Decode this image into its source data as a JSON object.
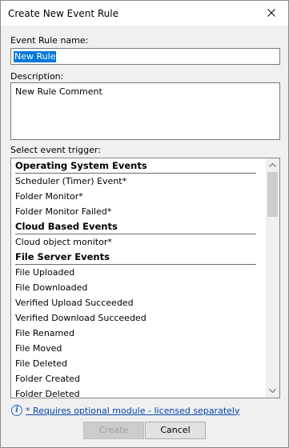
{
  "window": {
    "title": "Create New Event Rule"
  },
  "form": {
    "name_label": "Event Rule name:",
    "name_value": "New Rule",
    "description_label": "Description:",
    "description_value": "New Rule Comment",
    "trigger_label": "Select event trigger:"
  },
  "triggers": [
    {
      "label": "Operating System Events",
      "header": true
    },
    {
      "label": "Scheduler (Timer) Event*",
      "header": false
    },
    {
      "label": "Folder Monitor*",
      "header": false
    },
    {
      "label": "Folder Monitor Failed*",
      "header": false
    },
    {
      "label": "Cloud Based Events",
      "header": true
    },
    {
      "label": "Cloud object monitor*",
      "header": false
    },
    {
      "label": "File Server Events",
      "header": true
    },
    {
      "label": "File Uploaded",
      "header": false
    },
    {
      "label": "File Downloaded",
      "header": false
    },
    {
      "label": "Verified Upload Succeeded",
      "header": false
    },
    {
      "label": "Verified Download Succeeded",
      "header": false
    },
    {
      "label": "File Renamed",
      "header": false
    },
    {
      "label": "File Moved",
      "header": false
    },
    {
      "label": "File Deleted",
      "header": false
    },
    {
      "label": "Folder Created",
      "header": false
    },
    {
      "label": "Folder Deleted",
      "header": false
    }
  ],
  "footnote": {
    "icon": "info-icon",
    "text": "* Requires optional module - licensed separately"
  },
  "buttons": {
    "create_label": "Create",
    "create_disabled": true,
    "cancel_label": "Cancel"
  }
}
